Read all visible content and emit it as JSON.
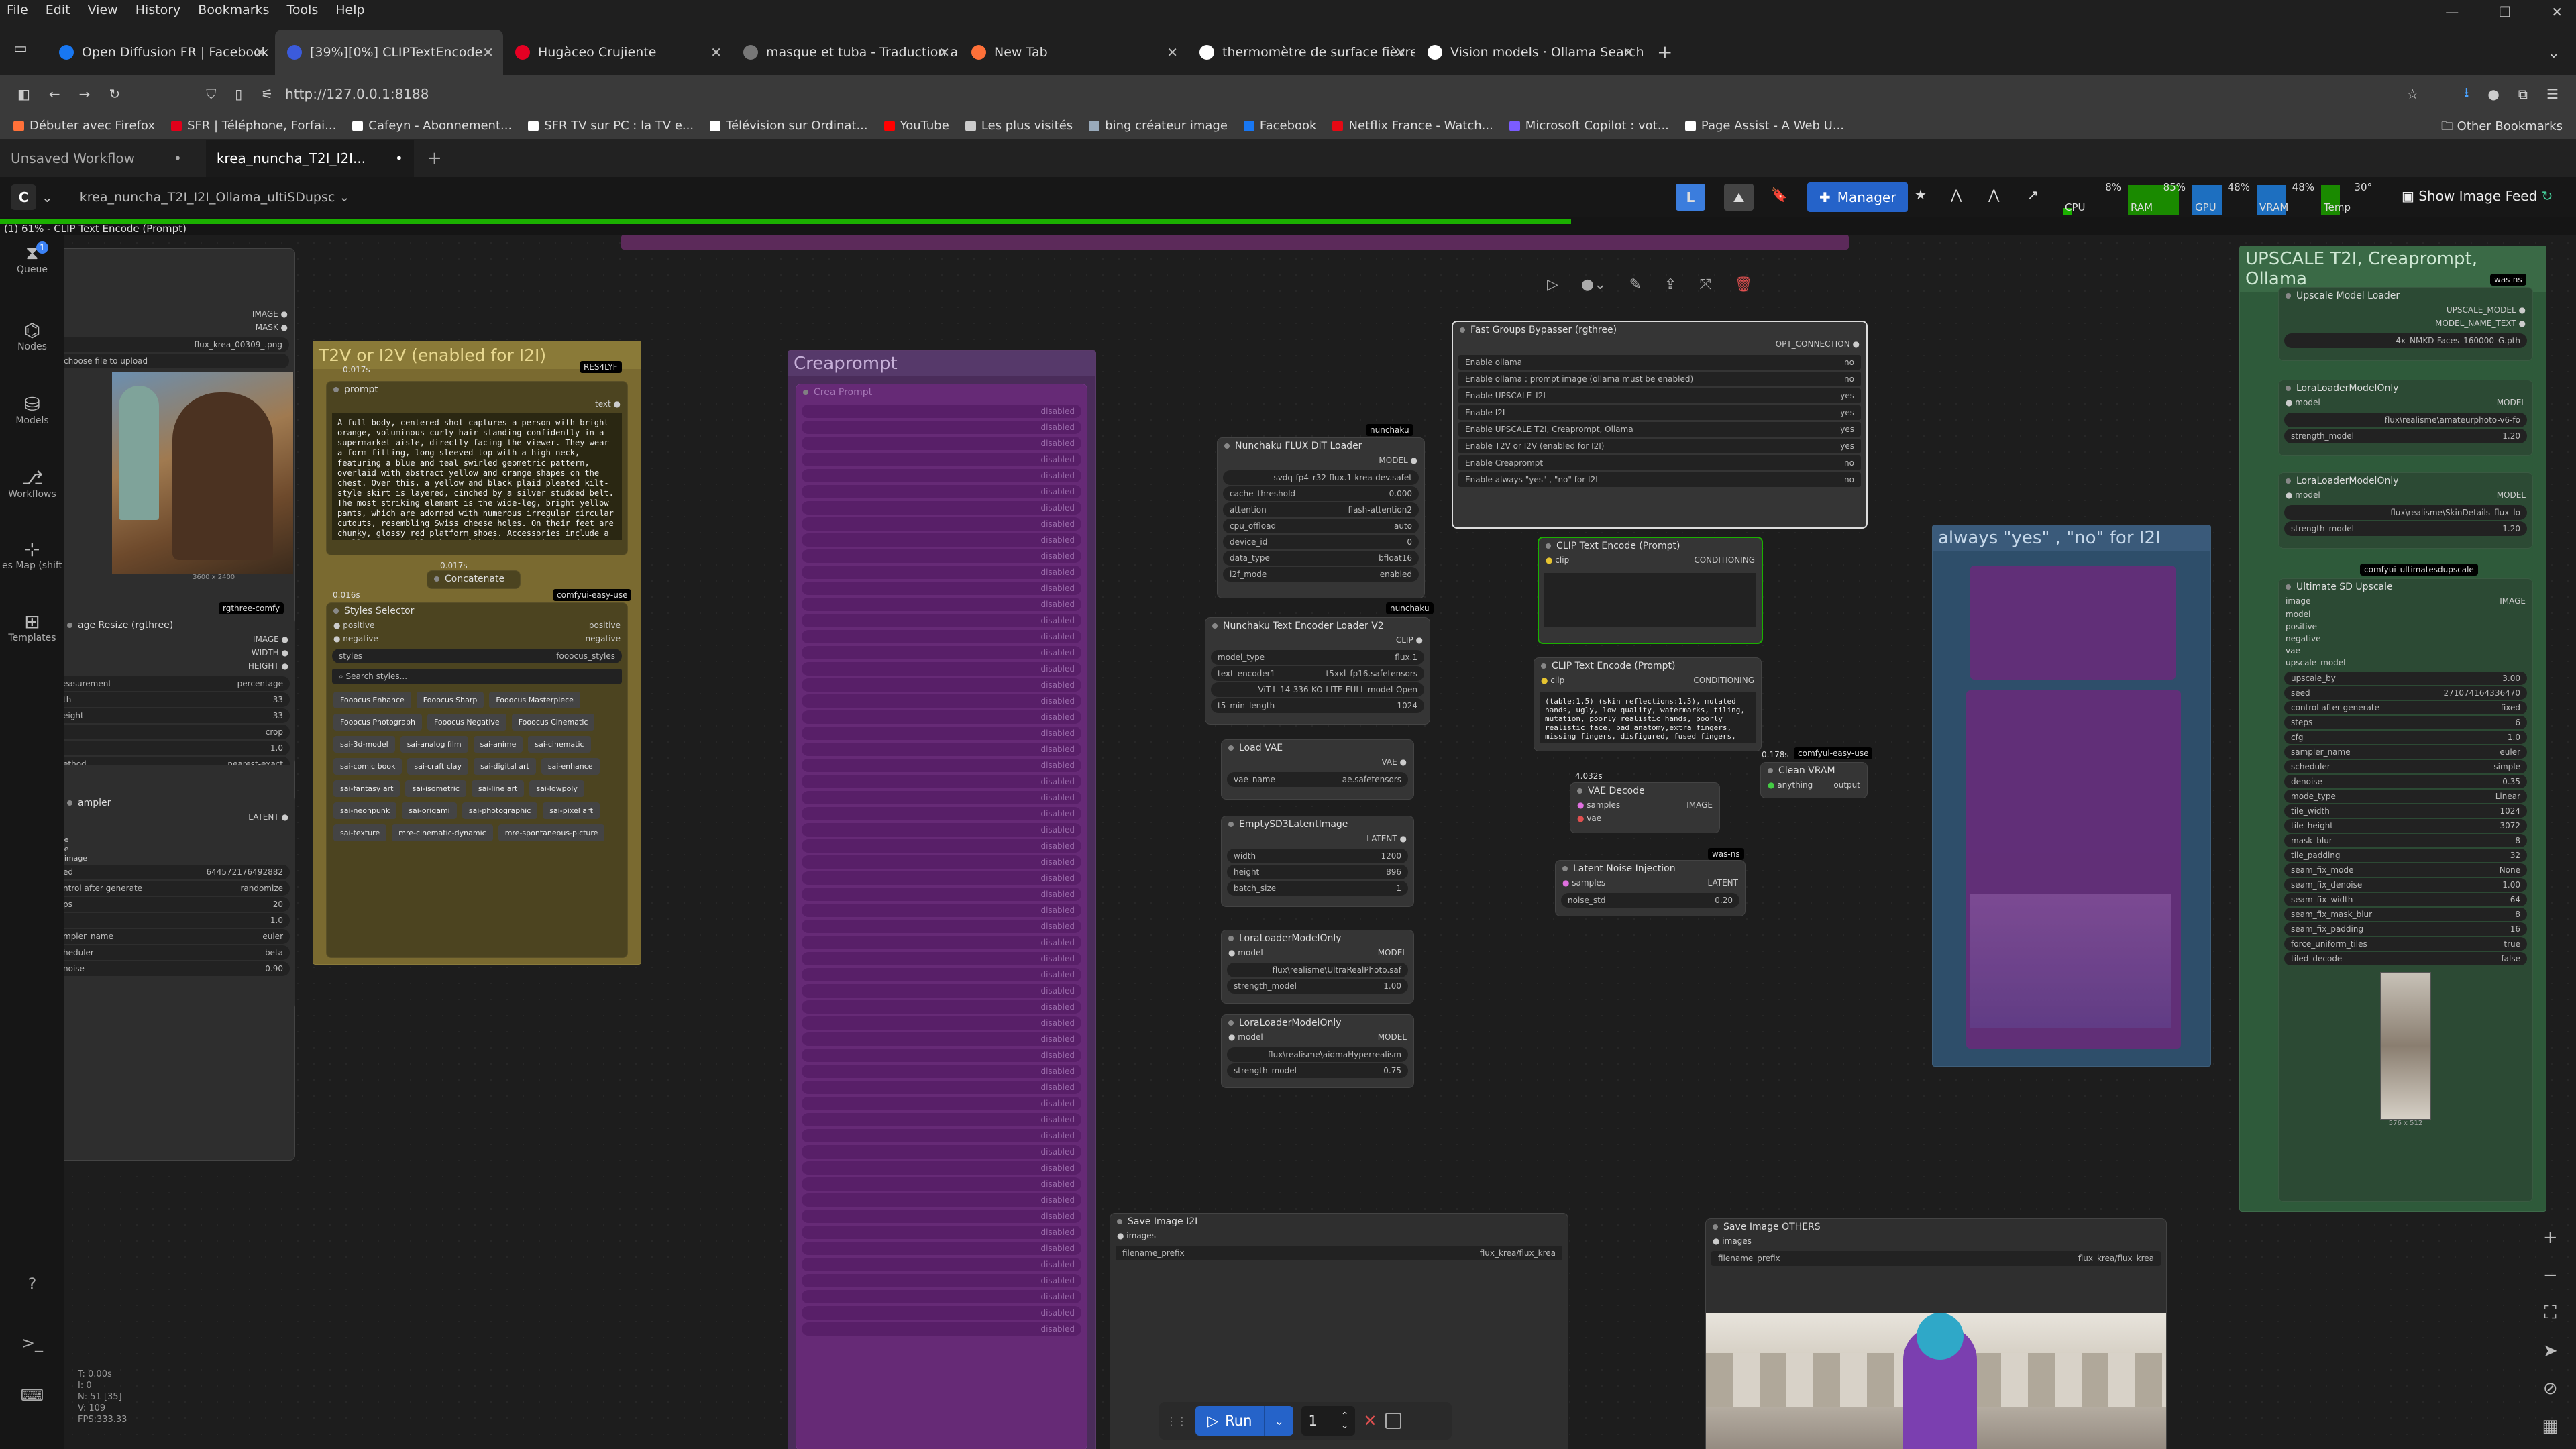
{
  "menu": [
    "File",
    "Edit",
    "View",
    "History",
    "Bookmarks",
    "Tools",
    "Help"
  ],
  "browser_tabs": [
    {
      "label": "Open Diffusion FR | Facebook",
      "color": "#1877f2"
    },
    {
      "label": "[39%][0%] CLIPTextEncode",
      "color": "#3b5bdb",
      "active": true
    },
    {
      "label": "Hugàceo Crujiente",
      "color": "#e60023"
    },
    {
      "label": "masque et tuba - Traduction an",
      "color": "#777777"
    },
    {
      "label": "New Tab",
      "color": "#ff7139"
    },
    {
      "label": "thermomètre de surface fièvre",
      "color": "#ffffff"
    },
    {
      "label": "Vision models · Ollama Search",
      "color": "#ffffff"
    }
  ],
  "url": "http://127.0.0.1:8188",
  "bookmarks": [
    "Débuter avec Firefox",
    "SFR | Téléphone, Forfai...",
    "Cafeyn - Abonnement...",
    "SFR TV sur PC : la TV e...",
    "Télévision sur Ordinat...",
    "YouTube",
    "Les plus visités",
    "bing créateur image",
    "Facebook",
    "Netflix France - Watch...",
    "Microsoft Copilot : vot...",
    "Page Assist - A Web U..."
  ],
  "other_bookmarks": "Other Bookmarks",
  "workflow_tabs": [
    "Unsaved Workflow",
    "krea_nuncha_T2I_I2I..."
  ],
  "workflow_name": "krea_nuncha_T2I_I2I_Ollama_ultiSDupsc",
  "manager_label": "Manager",
  "stats": {
    "cpu": "CPU",
    "cpu_v": "8%",
    "ram": "RAM",
    "ram_v": "85%",
    "gpu": "GPU",
    "gpu_v": "48%",
    "vram": "VRAM",
    "vram_v": "48%",
    "temp": "Temp",
    "temp_v": "30°"
  },
  "show_image_feed": "Show Image Feed",
  "progress": {
    "text": "(1) 61% - CLIP Text Encode (Prompt)",
    "fraction": 0.61
  },
  "sidebar": [
    {
      "icon": "queue-icon",
      "label": "Queue",
      "count": "1"
    },
    {
      "icon": "nodes-icon",
      "label": "Nodes"
    },
    {
      "icon": "models-icon",
      "label": "Models"
    },
    {
      "icon": "workflows-icon",
      "label": "Workflows"
    },
    {
      "icon": "map-icon",
      "label": "es Map (shift"
    },
    {
      "icon": "templates-icon",
      "label": "Templates"
    }
  ],
  "stats_overlay": [
    "T: 0.00s",
    "I: 0",
    "N: 51 [35]",
    "V: 109",
    "FPS:333.33"
  ],
  "groups": {
    "t2v": "T2V or I2V (enabled for I2I)",
    "creaprompt": "Creaprompt",
    "always": "always \"yes\" , \"no\" for I2I",
    "upscale": "UPSCALE T2I, Creaprompt, Ollama"
  },
  "load_image": {
    "outputs": [
      "IMAGE",
      "MASK"
    ],
    "file": "flux_krea_00309_.png",
    "upload": "choose file to upload",
    "dims": "3600 x 2400"
  },
  "image_resize": {
    "title": "age Resize (rgthree)",
    "outputs": [
      "IMAGE",
      "WIDTH",
      "HEIGHT"
    ],
    "rows": [
      [
        "easurement",
        "percentage"
      ],
      [
        "th",
        "33"
      ],
      [
        "eight",
        "33"
      ],
      [
        "",
        "crop"
      ],
      [
        "",
        "1.0"
      ],
      [
        "ethod",
        "nearest-exact"
      ]
    ]
  },
  "ksampler": {
    "title": "ampler",
    "out": "LATENT",
    "rows": [
      [
        "ed",
        "644572176492882"
      ],
      [
        "ntrol after generate",
        "randomize"
      ],
      [
        "ps",
        "20"
      ],
      [
        "",
        "1.0"
      ],
      [
        "mpler_name",
        "euler"
      ],
      [
        "heduler",
        "beta"
      ],
      [
        "noise",
        "0.90"
      ]
    ],
    "inputs": [
      "el",
      "ive",
      "ive",
      "t_image"
    ]
  },
  "prompt_node": {
    "title": "prompt",
    "time": "0.017s",
    "label": "text",
    "badge": "RES4LYF",
    "text": "A full-body, centered shot captures a person with bright orange, voluminous curly hair standing confidently in a supermarket aisle, directly facing the viewer. They wear a form-fitting, long-sleeved top with a high neck, featuring a blue and teal swirled geometric pattern, overlaid with abstract yellow and orange shapes on the chest. Over this, a yellow and black plaid pleated kilt-style skirt is layered, cinched by a silver studded belt. The most striking element is the wide-leg, bright yellow pants, which are adorned with numerous irregular circular cutouts, resembling Swiss cheese holes. On their feet are chunky, glossy red platform shoes. Accessories include a small, textured blue beret-like hat, oversized red rectangular sunglasses with a prominent red nose bridge, and large dangling red earrings. Their long fingernails are painted a dark"
  },
  "concatenate": {
    "title": "Concatenate",
    "time": "0.017s",
    "badge": "comfyui-easy-use",
    "time2": "0.016s"
  },
  "styles": {
    "title": "Styles Selector",
    "inputs": [
      "positive",
      "negative"
    ],
    "field": "styles",
    "value": "fooocus_styles",
    "search": "Search styles...",
    "tags": [
      "Fooocus Enhance",
      "Fooocus Sharp",
      "Fooocus Masterpiece",
      "Fooocus Photograph",
      "Fooocus Negative",
      "Fooocus Cinematic",
      "sai-3d-model",
      "sai-analog film",
      "sai-anime",
      "sai-cinematic",
      "sai-comic book",
      "sai-craft clay",
      "sai-digital art",
      "sai-enhance",
      "sai-fantasy art",
      "sai-isometric",
      "sai-line art",
      "sai-lowpoly",
      "sai-neonpunk",
      "sai-origami",
      "sai-photographic",
      "sai-pixel art",
      "sai-texture",
      "mre-cinematic-dynamic",
      "mre-spontaneous-picture"
    ]
  },
  "creaprompt_node": {
    "title": "Crea Prompt",
    "badge": "creaprompt",
    "row_value": "disabled"
  },
  "fast_bypass": {
    "title": "Fast Groups Bypasser (rgthree)",
    "out": "OPT_CONNECTION",
    "rows": [
      [
        "Enable ollama",
        "no"
      ],
      [
        "Enable ollama : prompt image (ollama must be enabled)",
        "no"
      ],
      [
        "Enable UPSCALE_I2I",
        "yes"
      ],
      [
        "Enable I2I",
        "yes"
      ],
      [
        "Enable UPSCALE T2I, Creaprompt, Ollama",
        "yes"
      ],
      [
        "Enable T2V or I2V (enabled for I2I)",
        "yes"
      ],
      [
        "Enable Creaprompt",
        "no"
      ],
      [
        "Enable always \"yes\" , \"no\" for I2I",
        "no"
      ]
    ]
  },
  "flux_loader": {
    "title": "Nunchaku FLUX DiT Loader",
    "badge": "nunchaku",
    "out": "MODEL",
    "rows": [
      [
        "",
        "svdq-fp4_r32-flux.1-krea-dev.safet"
      ],
      [
        "cache_threshold",
        "0.000"
      ],
      [
        "attention",
        "flash-attention2"
      ],
      [
        "cpu_offload",
        "auto"
      ],
      [
        "device_id",
        "0"
      ],
      [
        "data_type",
        "bfloat16"
      ],
      [
        "i2f_mode",
        "enabled"
      ]
    ]
  },
  "text_encoder": {
    "title": "Nunchaku Text Encoder Loader V2",
    "badge": "nunchaku",
    "out": "CLIP",
    "rows": [
      [
        "model_type",
        "flux.1"
      ],
      [
        "text_encoder1",
        "t5xxl_fp16.safetensors"
      ],
      [
        "",
        "ViT-L-14-336-KO-LITE-FULL-model-Open"
      ],
      [
        "t5_min_length",
        "1024"
      ]
    ]
  },
  "load_vae": {
    "title": "Load VAE",
    "out": "VAE",
    "rows": [
      [
        "vae_name",
        "ae.safetensors"
      ]
    ]
  },
  "empty_latent": {
    "title": "EmptySD3LatentImage",
    "out": "LATENT",
    "rows": [
      [
        "width",
        "1200"
      ],
      [
        "height",
        "896"
      ],
      [
        "batch_size",
        "1"
      ]
    ]
  },
  "lora1": {
    "title": "LoraLoaderModelOnly",
    "io": [
      "model",
      "MODEL"
    ],
    "rows": [
      [
        "",
        "flux\\realisme\\UltraRealPhoto.saf"
      ],
      [
        "strength_model",
        "1.00"
      ]
    ]
  },
  "lora2": {
    "title": "LoraLoaderModelOnly",
    "io": [
      "model",
      "MODEL"
    ],
    "rows": [
      [
        "",
        "flux\\realisme\\aidmaHyperrealism"
      ],
      [
        "strength_model",
        "0.75"
      ]
    ]
  },
  "clip_encode1": {
    "title": "CLIP Text Encode (Prompt)",
    "io": [
      "clip",
      "CONDITIONING"
    ]
  },
  "clip_encode2": {
    "title": "CLIP Text Encode (Prompt)",
    "io": [
      "clip",
      "CONDITIONING"
    ],
    "text": "(table:1.5) (skin reflections:1.5), mutated hands, ugly, low quality, watermarks, tiling, mutation, poorly realistic hands, poorly realistic face, bad anatomy,extra fingers, missing fingers, disfigured, fused fingers,"
  },
  "clean_vram": {
    "title": "Clean VRAM",
    "io": [
      "anything",
      "output"
    ],
    "badge": "comfyui-easy-use",
    "time": "0.178s"
  },
  "vae_decode": {
    "title": "VAE Decode",
    "time": "4.032s",
    "inputs": [
      "samples",
      "vae"
    ],
    "out": "IMAGE",
    "badge": "was-ns"
  },
  "latent_noise": {
    "title": "Latent Noise Injection",
    "io": [
      "samples",
      "LATENT"
    ],
    "rows": [
      [
        "noise_std",
        "0.20"
      ]
    ]
  },
  "upscale_loader": {
    "title": "Upscale Model Loader",
    "badge": "was-ns",
    "outputs": [
      "UPSCALE_MODEL",
      "MODEL_NAME_TEXT"
    ],
    "value": "4x_NMKD-Faces_160000_G.pth"
  },
  "lora_up1": {
    "title": "LoraLoaderModelOnly",
    "io": [
      "model",
      "MODEL"
    ],
    "rows": [
      [
        "",
        "flux\\realisme\\amateurphoto-v6-fo"
      ],
      [
        "strength_model",
        "1.20"
      ]
    ]
  },
  "lora_up2": {
    "title": "LoraLoaderModelOnly",
    "io": [
      "model",
      "MODEL"
    ],
    "rows": [
      [
        "",
        "flux\\realisme\\SkinDetails_flux_lo"
      ],
      [
        "strength_model",
        "1.20"
      ]
    ]
  },
  "ultimate": {
    "title": "Ultimate SD Upscale",
    "badge": "comfyui_ultimatesdupscale",
    "out": "IMAGE",
    "inputs": [
      "image",
      "model",
      "positive",
      "negative",
      "vae",
      "upscale_model"
    ],
    "rows": [
      [
        "upscale_by",
        "3.00"
      ],
      [
        "seed",
        "271074164336470"
      ],
      [
        "control after generate",
        "fixed"
      ],
      [
        "steps",
        "6"
      ],
      [
        "cfg",
        "1.0"
      ],
      [
        "sampler_name",
        "euler"
      ],
      [
        "scheduler",
        "simple"
      ],
      [
        "denoise",
        "0.35"
      ],
      [
        "mode_type",
        "Linear"
      ],
      [
        "tile_width",
        "1024"
      ],
      [
        "tile_height",
        "3072"
      ],
      [
        "mask_blur",
        "8"
      ],
      [
        "tile_padding",
        "32"
      ],
      [
        "seam_fix_mode",
        "None"
      ],
      [
        "seam_fix_denoise",
        "1.00"
      ],
      [
        "seam_fix_width",
        "64"
      ],
      [
        "seam_fix_mask_blur",
        "8"
      ],
      [
        "seam_fix_padding",
        "16"
      ],
      [
        "force_uniform_tiles",
        "true"
      ],
      [
        "tiled_decode",
        "false"
      ]
    ],
    "thumb_dims": "576 x 512"
  },
  "save1": {
    "title": "Save Image  I2I",
    "input": "images",
    "field": "filename_prefix",
    "value": "flux_krea/flux_krea"
  },
  "save2": {
    "title": "Save Image  OTHERS",
    "input": "images",
    "field": "filename_prefix",
    "value": "flux_krea/flux_krea"
  },
  "run": {
    "label": "Run",
    "count": "1"
  }
}
